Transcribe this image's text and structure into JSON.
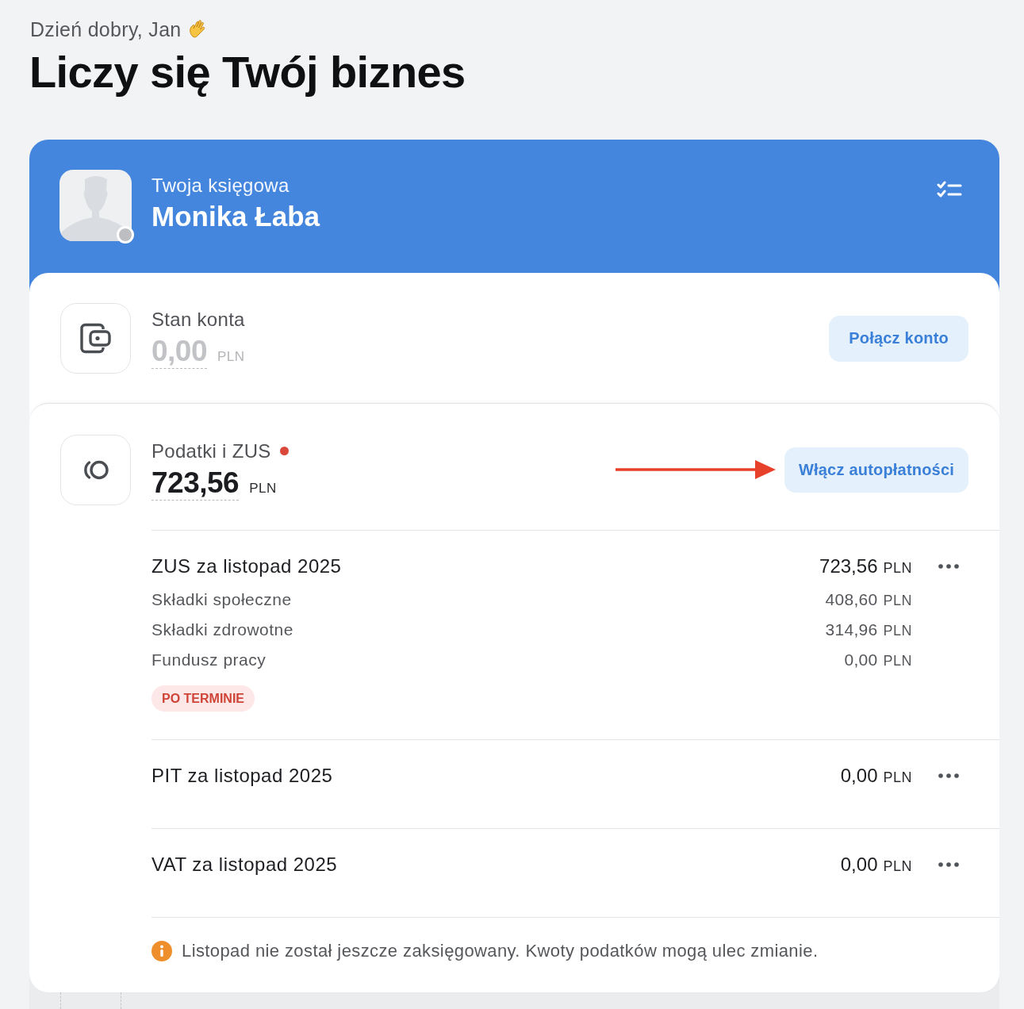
{
  "greeting": "Dzień dobry, Jan",
  "headline": "Liczy się Twój biznes",
  "accountant": {
    "caption": "Twoja księgowa",
    "name": "Monika Łaba",
    "online": false
  },
  "balance": {
    "label": "Stan konta",
    "amount": "0,00",
    "currency": "PLN",
    "inactive": true,
    "button": "Połącz konto"
  },
  "taxes": {
    "label": "Podatki i ZUS",
    "alert": true,
    "amount": "723,56",
    "currency": "PLN",
    "inactive": false,
    "button": "Włącz autopłatności",
    "items": [
      {
        "title": "ZUS za listopad 2025",
        "amount": "723,56",
        "currency": "PLN",
        "lines": [
          {
            "label": "Składki społeczne",
            "amount": "408,60",
            "currency": "PLN"
          },
          {
            "label": "Składki zdrowotne",
            "amount": "314,96",
            "currency": "PLN"
          },
          {
            "label": "Fundusz pracy",
            "amount": "0,00",
            "currency": "PLN"
          }
        ],
        "status": {
          "label": "PO TERMINIE",
          "kind": "overdue"
        }
      },
      {
        "title": "PIT za listopad 2025",
        "amount": "0,00",
        "currency": "PLN"
      },
      {
        "title": "VAT za listopad 2025",
        "amount": "0,00",
        "currency": "PLN"
      }
    ],
    "note": "Listopad nie został jeszcze zaksięgowany. Kwoty podatków mogą ulec zmianie."
  }
}
